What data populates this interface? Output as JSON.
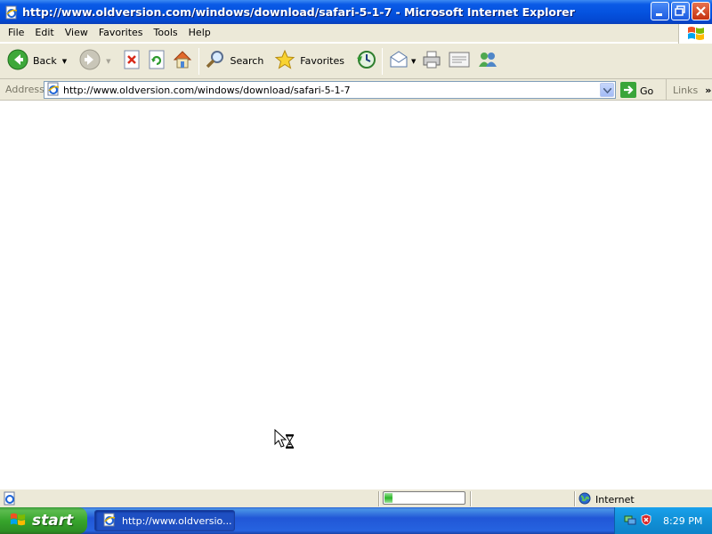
{
  "window": {
    "title": "http://www.oldversion.com/windows/download/safari-5-1-7 - Microsoft Internet Explorer"
  },
  "menubar": {
    "items": [
      "File",
      "Edit",
      "View",
      "Favorites",
      "Tools",
      "Help"
    ]
  },
  "toolbar": {
    "back_label": "Back",
    "search_label": "Search",
    "favorites_label": "Favorites"
  },
  "address_bar": {
    "label": "Address",
    "url": "http://www.oldversion.com/windows/download/safari-5-1-7",
    "go_label": "Go",
    "links_label": "Links"
  },
  "status_bar": {
    "text": "",
    "progress_fraction": 0.1,
    "zone_label": "Internet"
  },
  "taskbar": {
    "start_label": "start",
    "task_button_label": "http://www.oldversio...",
    "clock": "8:29 PM"
  },
  "colors": {
    "titlebar_blue": "#0553e0",
    "chrome_beige": "#ece9d8",
    "start_green": "#37a52c",
    "tray_blue": "#1190d6"
  },
  "icons": [
    "ie-page-icon",
    "minimize-icon",
    "maximize-icon",
    "close-icon",
    "windows-logo-icon",
    "back-arrow-icon",
    "forward-arrow-icon",
    "stop-icon",
    "refresh-icon",
    "home-icon",
    "search-icon",
    "favorites-star-icon",
    "history-icon",
    "mail-icon",
    "print-icon",
    "edit-icon",
    "messenger-icon",
    "go-arrow-icon",
    "globe-icon",
    "hourglass-cursor-icon",
    "network-icon",
    "security-shield-icon"
  ]
}
